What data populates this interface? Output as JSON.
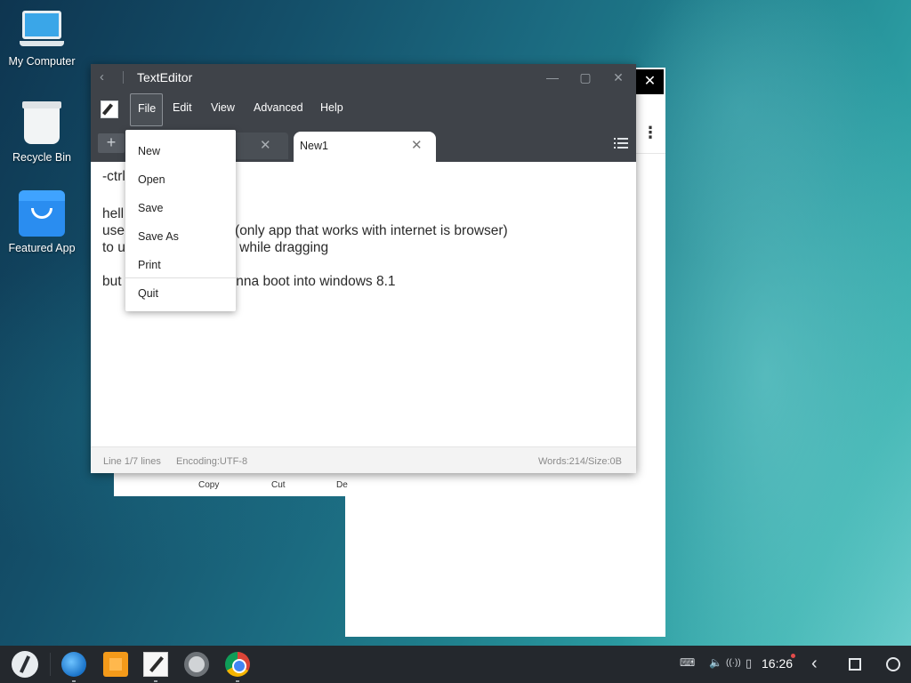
{
  "desktop": {
    "icons": [
      {
        "label": "My Computer",
        "icon": "laptop-icon"
      },
      {
        "label": "Recycle Bin",
        "icon": "trash-icon"
      },
      {
        "label": "Featured App",
        "icon": "shopping-bag-icon"
      }
    ]
  },
  "background_window": {
    "close_glyph": "✕",
    "menu_glyph": "⋮",
    "context_actions": [
      "Copy",
      "Cut",
      "De"
    ]
  },
  "window": {
    "title": "TextEditor",
    "back_glyph": "‹",
    "minimize_glyph": "—",
    "maximize_glyph": "▢",
    "close_glyph": "✕"
  },
  "menubar": {
    "items": [
      "File",
      "Edit",
      "View",
      "Advanced",
      "Help"
    ],
    "active": "File"
  },
  "tabs": {
    "add_glyph": "+",
    "close_glyph": "✕",
    "active_label": "New1"
  },
  "editor": {
    "lines": [
      "-ctrl",
      "",
      "hell                    d oS",
      "use                   APKs (only app that works with internet is browser)",
      "to u                  ld click while dragging",
      "",
      "but                   u're gonna boot into windows 8.1"
    ]
  },
  "file_menu": {
    "items": [
      "New",
      "Open",
      "Save",
      "Save As",
      "Print",
      "Quit"
    ]
  },
  "statusbar": {
    "position": "Line 1/7 lines",
    "encoding": "Encoding:UTF-8",
    "stats": "Words:214/Size:0B"
  },
  "taskbar": {
    "apps": [
      "browser-icon",
      "file-manager-icon",
      "text-editor-icon",
      "settings-icon",
      "chrome-icon"
    ],
    "tray_keyboard": "⌨",
    "tray_volume": "🔈",
    "tray_network": "((·))",
    "tray_battery": "▯",
    "clock": "16:26",
    "nav_back": "‹"
  }
}
